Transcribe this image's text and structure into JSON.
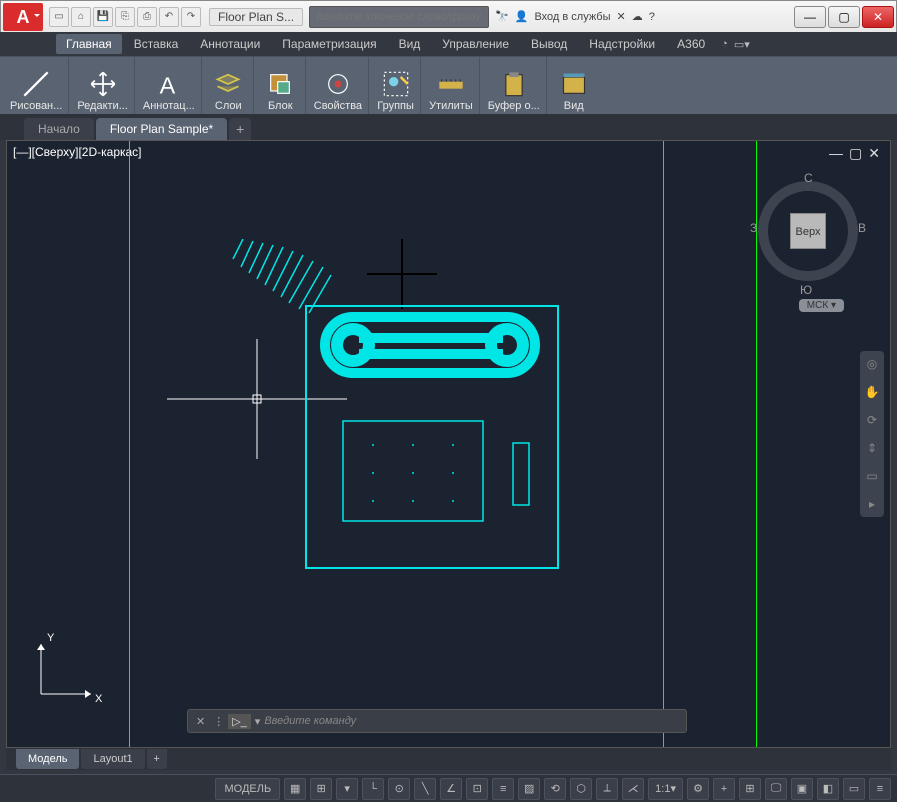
{
  "app": {
    "logo": "A",
    "title_tab": "Floor Plan S...",
    "search_placeholder": "Введите ключевое слово/фразу",
    "login_label": "Вход в службы"
  },
  "menubar": {
    "items": [
      "Главная",
      "Вставка",
      "Аннотации",
      "Параметризация",
      "Вид",
      "Управление",
      "Вывод",
      "Надстройки",
      "A360"
    ],
    "active_index": 0
  },
  "ribbon": {
    "panels": [
      {
        "label": "Рисован..."
      },
      {
        "label": "Редакти..."
      },
      {
        "label": "Аннотац..."
      },
      {
        "label": "Слои"
      },
      {
        "label": "Блок"
      },
      {
        "label": "Свойства"
      },
      {
        "label": "Группы"
      },
      {
        "label": "Утилиты"
      },
      {
        "label": "Буфер о..."
      },
      {
        "label": "Вид"
      }
    ]
  },
  "filetabs": {
    "items": [
      {
        "label": "Начало",
        "active": false
      },
      {
        "label": "Floor Plan Sample*",
        "active": true
      }
    ]
  },
  "view": {
    "label": "[—][Сверху][2D-каркас]"
  },
  "compass": {
    "face": "Верх",
    "n": "С",
    "w": "З",
    "e": "В",
    "s": "Ю"
  },
  "mck": "МСК",
  "ucs": {
    "x": "X",
    "y": "Y"
  },
  "cmdline": {
    "placeholder": "Введите команду"
  },
  "layouttabs": {
    "items": [
      {
        "label": "Модель",
        "active": true
      },
      {
        "label": "Layout1",
        "active": false
      }
    ]
  },
  "statusbar": {
    "model": "МОДЕЛЬ",
    "scale": "1:1"
  }
}
